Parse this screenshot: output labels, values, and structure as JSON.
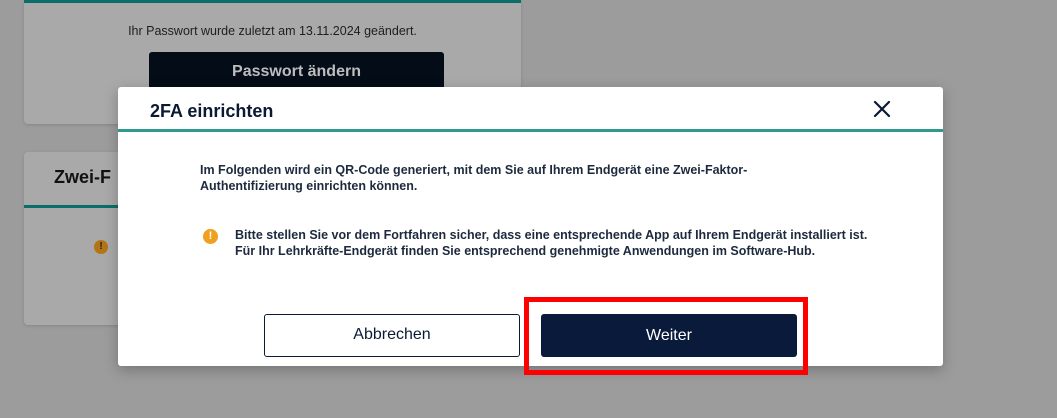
{
  "background": {
    "password_card": {
      "info_text": "Ihr Passwort wurde zuletzt am 13.11.2024 geändert.",
      "change_button_label": "Passwort ändern"
    },
    "twofa_card": {
      "title_visible": "Zwei-F",
      "warning_icon": "!"
    }
  },
  "modal": {
    "title": "2FA einrichten",
    "close_icon": "×",
    "intro_text": "Im Folgenden wird ein QR-Code generiert, mit dem Sie auf Ihrem Endgerät eine Zwei-Faktor-Authentifizierung einrichten können.",
    "warning_icon": "!",
    "warning_text": "Bitte stellen Sie vor dem Fortfahren sicher, dass eine entsprechende App auf Ihrem Endgerät installiert ist. Für Ihr Lehrkräfte-Endgerät finden Sie entsprechend genehmigte Anwendungen im Software-Hub.",
    "cancel_label": "Abbrechen",
    "next_label": "Weiter"
  },
  "colors": {
    "accent_teal": "#2e9a8d",
    "primary_navy": "#0a1a3a",
    "warning_orange": "#f0a020",
    "highlight_red": "#ff0000"
  }
}
